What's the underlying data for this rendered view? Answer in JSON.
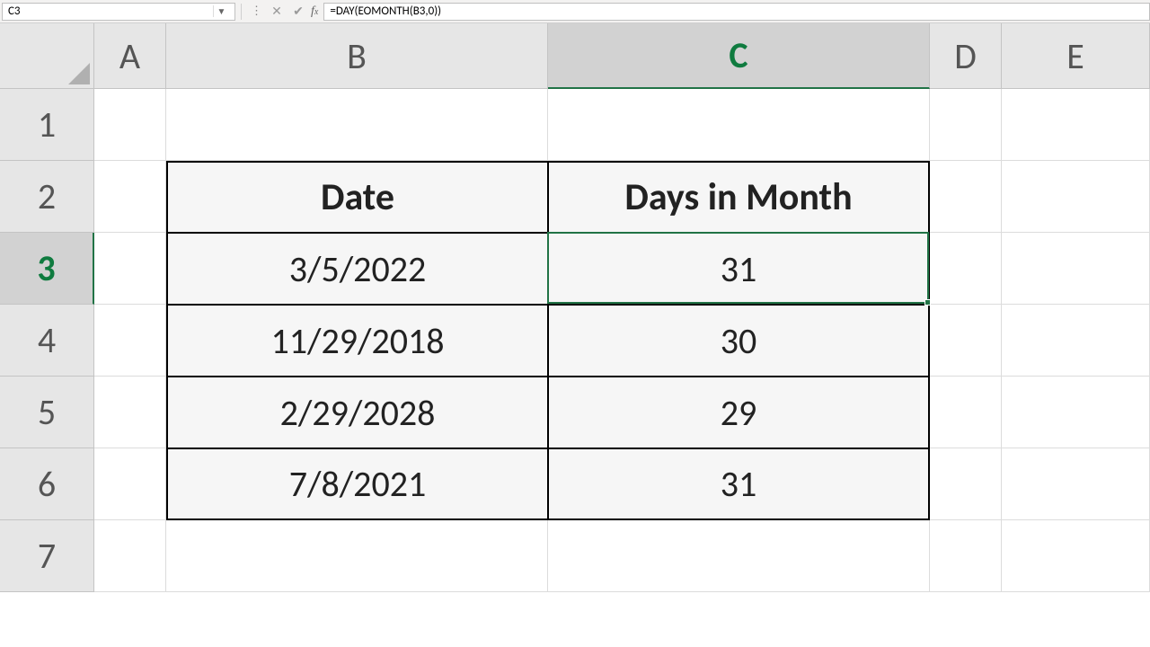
{
  "formula_bar": {
    "name_box": "C3",
    "formula": "=DAY(EOMONTH(B3,0))"
  },
  "columns": {
    "A": "A",
    "B": "B",
    "C": "C",
    "D": "D",
    "E": "E"
  },
  "rows": {
    "1": "1",
    "2": "2",
    "3": "3",
    "4": "4",
    "5": "5",
    "6": "6",
    "7": "7"
  },
  "table": {
    "headers": {
      "date": "Date",
      "days": "Days in Month"
    },
    "rows": [
      {
        "date": "3/5/2022",
        "days": "31"
      },
      {
        "date": "11/29/2018",
        "days": "30"
      },
      {
        "date": "2/29/2028",
        "days": "29"
      },
      {
        "date": "7/8/2021",
        "days": "31"
      }
    ]
  },
  "active_cell": "C3",
  "chart_data": {
    "type": "table",
    "columns": [
      "Date",
      "Days in Month"
    ],
    "rows": [
      [
        "3/5/2022",
        31
      ],
      [
        "11/29/2018",
        30
      ],
      [
        "2/29/2028",
        29
      ],
      [
        "7/8/2021",
        31
      ]
    ]
  }
}
